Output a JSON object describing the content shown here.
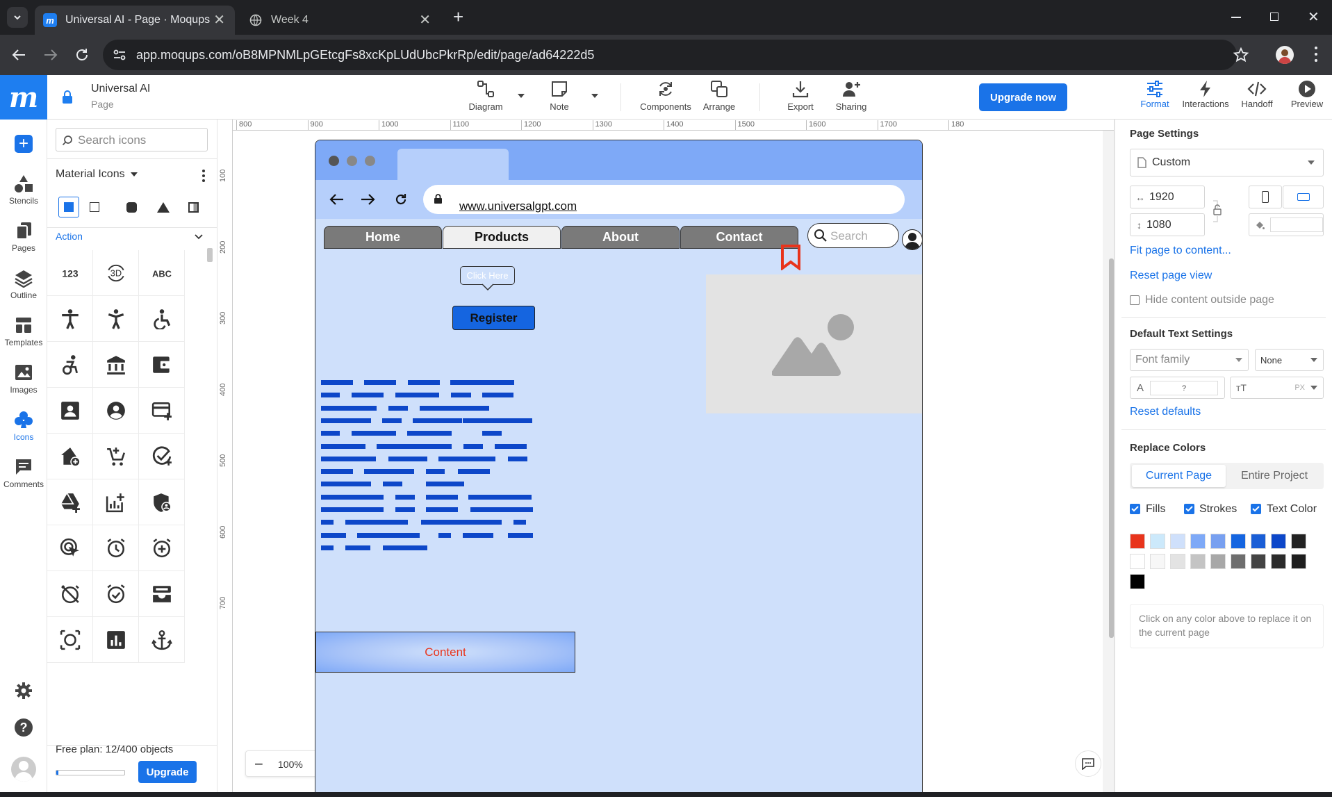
{
  "browser": {
    "tabs": [
      {
        "title": "Universal AI - Page · Moqups",
        "active": true
      },
      {
        "title": "Week 4",
        "active": false
      }
    ],
    "url": "app.moqups.com/oB8MPNMLpGEtcgFs8xcKpLUdUbcPkrRp/edit/page/ad64222d5"
  },
  "app": {
    "project_title": "Universal AI",
    "page_label": "Page",
    "toolbar": {
      "diagram": "Diagram",
      "note": "Note",
      "components": "Components",
      "arrange": "Arrange",
      "export": "Export",
      "sharing": "Sharing",
      "upgrade_now": "Upgrade now",
      "format": "Format",
      "interactions": "Interactions",
      "handoff": "Handoff",
      "preview": "Preview"
    },
    "rail": [
      {
        "label": "Stencils"
      },
      {
        "label": "Pages"
      },
      {
        "label": "Outline"
      },
      {
        "label": "Templates"
      },
      {
        "label": "Images"
      },
      {
        "label": "Icons"
      },
      {
        "label": "Comments"
      }
    ],
    "icons_panel": {
      "search_placeholder": "Search icons",
      "library": "Material Icons",
      "category": "Action",
      "icons": [
        "123-icon",
        "3d-rotation-icon",
        "abc-icon",
        "accessibility-icon",
        "accessibility-new-icon",
        "accessible-icon",
        "accessible-forward-icon",
        "account-balance-icon",
        "account-balance-wallet-icon",
        "account-box-icon",
        "account-circle-icon",
        "add-card-icon",
        "add-home-icon",
        "add-shopping-cart-icon",
        "add-task-icon",
        "add-to-drive-icon",
        "addchart-icon",
        "admin-panel-settings-icon",
        "ads-click-icon",
        "alarm-icon",
        "alarm-add-icon",
        "alarm-off-icon",
        "alarm-on-icon",
        "all-inbox-icon",
        "all-out-icon",
        "analytics-icon",
        "anchor-icon"
      ],
      "plan_text": "Free plan: 12/400 objects",
      "plan_progress": 0.03,
      "upgrade": "Upgrade"
    },
    "canvas": {
      "ruler_top": [
        "800",
        "900",
        "1000",
        "1100",
        "1200",
        "1300",
        "1400",
        "1500",
        "1600",
        "1700",
        "180"
      ],
      "ruler_left": [
        "100",
        "200",
        "300",
        "400",
        "500",
        "600",
        "700"
      ],
      "zoom": "100%"
    },
    "mockup": {
      "url": "www.universalgpt.com",
      "nav": [
        "Home",
        "Products",
        "About",
        "Contact"
      ],
      "search_placeholder": "Search",
      "tooltip": "Click Here",
      "register": "Register",
      "content": "Content"
    },
    "right_panel": {
      "page_settings": "Page Settings",
      "preset": "Custom",
      "width": "1920",
      "height": "1080",
      "fit_page": "Fit page to content...",
      "reset_view": "Reset page view",
      "hide_outside": "Hide content outside page",
      "default_text": "Default Text Settings",
      "font_family_placeholder": "Font family",
      "font_style": "None",
      "font_color_value": "?",
      "font_unit": "PX",
      "reset_defaults": "Reset defaults",
      "replace_colors": "Replace Colors",
      "seg_current": "Current Page",
      "seg_entire": "Entire Project",
      "fills": "Fills",
      "strokes": "Strokes",
      "text_color": "Text Color",
      "swatches": [
        "#e8341c",
        "#cce9fb",
        "#cfe0fb",
        "#7ea9f7",
        "#78a0f0",
        "#1565e0",
        "#1a5ed6",
        "#0d47c9",
        "#222222",
        "#ffffff",
        "#f7f7f7",
        "#e3e3e3",
        "#c4c4c4",
        "#a8a8a8",
        "#6e6e6e",
        "#444444",
        "#2b2b2b",
        "#1e1e1e",
        "#000000"
      ],
      "hint": "Click on any color above to replace it on the current page"
    }
  }
}
